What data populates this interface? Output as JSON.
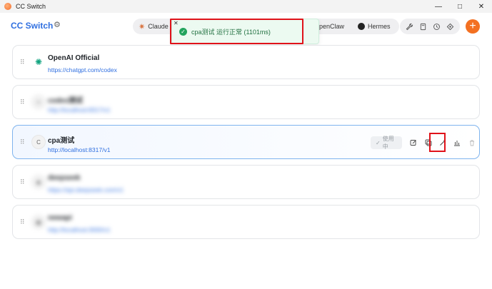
{
  "window": {
    "title": "CC Switch",
    "controls": [
      "—",
      "□",
      "✕"
    ]
  },
  "header": {
    "brand": "CC Switch",
    "tabs": [
      {
        "label": "Claude"
      },
      {
        "label": "OpenClaw"
      },
      {
        "label": "Hermes"
      }
    ],
    "add_label": "+"
  },
  "toast": {
    "message": "cpa测试 运行正常 (1101ms)",
    "close": "✕",
    "check": "✓"
  },
  "providers": [
    {
      "name": "OpenAI Official",
      "url": "https://chatgpt.com/codex",
      "avatar": "✺"
    },
    {
      "name": "codex测试",
      "url": "http://localhost:8317/v1",
      "avatar": "≡"
    },
    {
      "name": "cpa测试",
      "url": "http://localhost:8317/v1",
      "avatar": "C",
      "status": "使用中"
    },
    {
      "name": "deepseek",
      "url": "https://api.deepseek.com/v1",
      "avatar": "◆"
    },
    {
      "name": "newapi",
      "url": "http://localhost:3000/v1",
      "avatar": "▦"
    }
  ],
  "colors": {
    "accent": "#2f6fe0",
    "add": "#f37021",
    "highlight": "#e0121a",
    "success": "#22a45d"
  }
}
